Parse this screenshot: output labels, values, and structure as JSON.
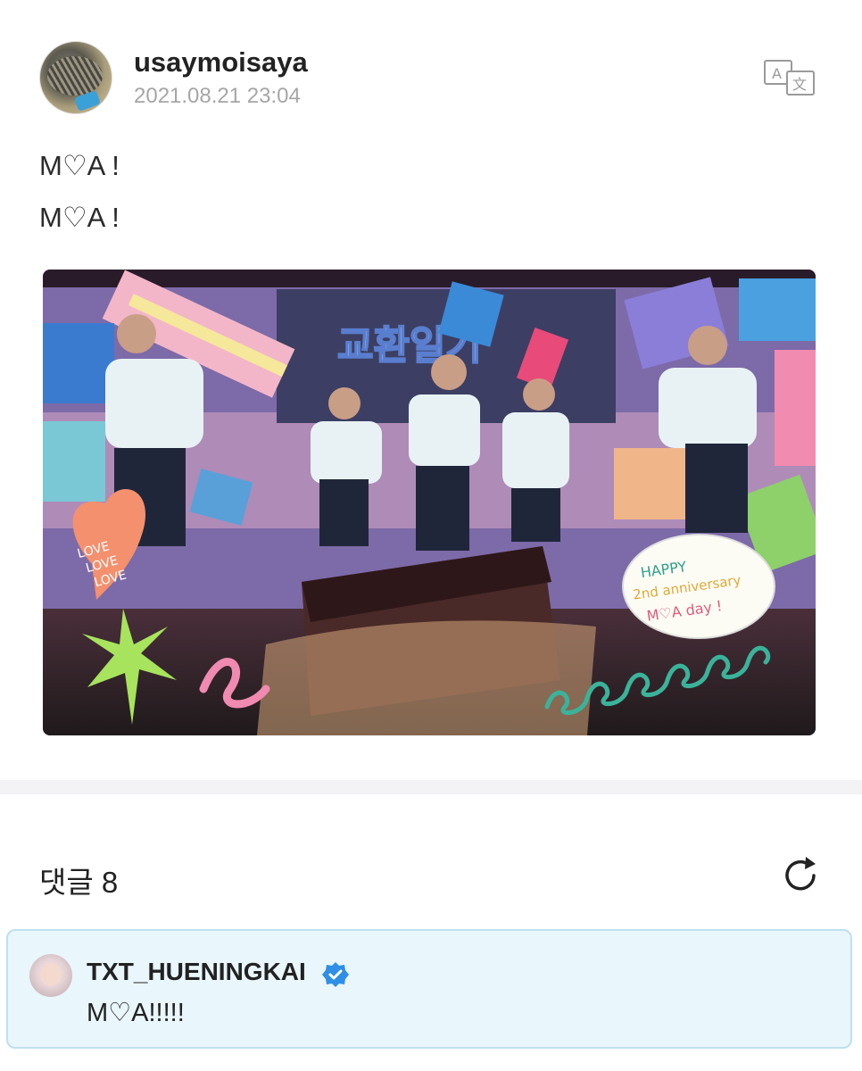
{
  "post": {
    "username": "usaymoisaya",
    "timestamp": "2021.08.21 23:04",
    "translate_icon": "translate-icon",
    "lines": [
      "M♡A !",
      "M♡A !"
    ]
  },
  "media": {
    "stage_sign": "교환일기",
    "sticker_love": [
      "LOVE",
      "LOVE",
      "LOVE"
    ],
    "sticker_happy": [
      "HAPPY",
      "2nd anniversary",
      "M♡A day !"
    ]
  },
  "comments": {
    "title": "댓글 8",
    "refresh_icon": "refresh-icon",
    "items": [
      {
        "author": "TXT_HUENINGKAI",
        "verified": true,
        "text": "M♡A!!!!!"
      }
    ]
  },
  "colors": {
    "comment_bg": "#e9f6fc",
    "verified_blue": "#2f8fe6",
    "timestamp_gray": "#a6a6a6"
  }
}
